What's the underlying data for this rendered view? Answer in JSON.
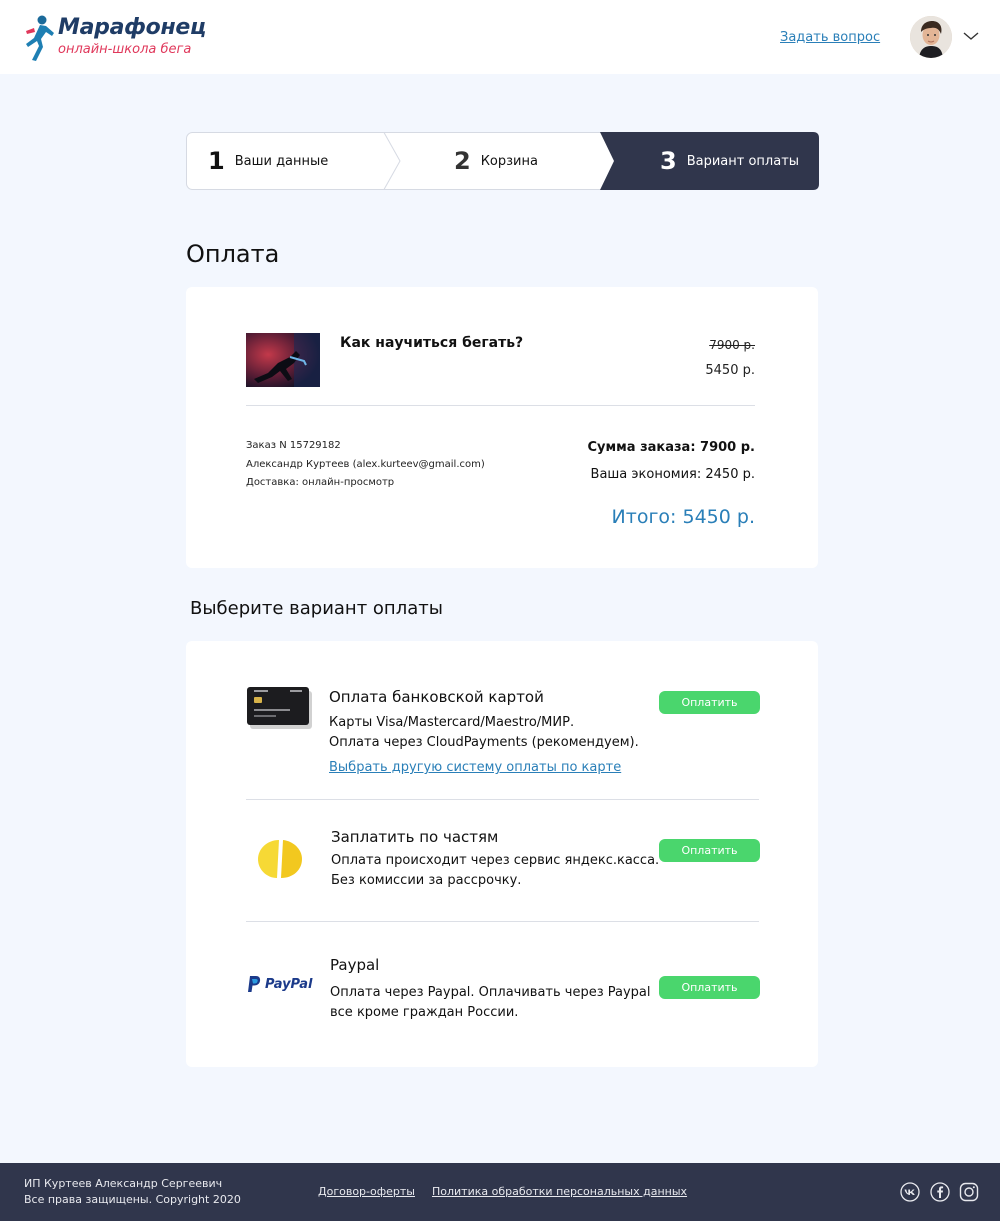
{
  "header": {
    "logo_name": "Марафонец",
    "logo_sub": "онлайн-школа бега",
    "ask_link": "Задать вопрос"
  },
  "stepper": {
    "steps": [
      {
        "num": "1",
        "label": "Ваши данные"
      },
      {
        "num": "2",
        "label": "Корзина"
      },
      {
        "num": "3",
        "label": "Вариант оплаты"
      }
    ],
    "active_color": "#30364c"
  },
  "page_title": "Оплата",
  "order": {
    "course_title": "Как научиться бегать?",
    "old_price": "7900 р.",
    "new_price": "5450 р.",
    "order_number": "Заказ N 15729182",
    "customer": "Александр Куртеев (alex.kurteev@gmail.com)",
    "delivery": "Доставка: онлайн-просмотр",
    "sum": "Сумма заказа: 7900 р.",
    "economy": "Ваша экономия: 2450 р.",
    "total": "Итого: 5450 р."
  },
  "choose_title": "Выберите вариант оплаты",
  "payments": [
    {
      "icon": "bank-card-icon",
      "title": "Оплата банковской картой",
      "desc1": "Карты Visa/Mastercard/Maestro/МИР.",
      "desc2": "Оплата через CloudPayments (рекомендуем).",
      "link": "Выбрать другую систему оплаты по карте",
      "button": "Оплатить"
    },
    {
      "icon": "yandex-kassa-icon",
      "title": "Заплатить по частям",
      "desc1": "Оплата происходит через сервис яндекс.касса.",
      "desc2": "Без комиссии за рассрочку.",
      "button": "Оплатить"
    },
    {
      "icon": "paypal-icon",
      "logo_text": "PayPal",
      "title": "Paypal",
      "desc1": "Оплата через Paypal. Оплачивать через Paypal",
      "desc2": "все кроме граждан России.",
      "button": "Оплатить"
    }
  ],
  "footer": {
    "company": "ИП Куртеев Александр Сергеевич",
    "rights": "Все права защищены. Copyright 2020",
    "links": [
      "Договор-оферты",
      "Политика обработки персональных данных"
    ],
    "socials": [
      "vk-icon",
      "facebook-icon",
      "instagram-icon"
    ]
  },
  "colors": {
    "accent": "#2a7fb8",
    "pay_button": "#4ad66d",
    "footer_bg": "#30364c",
    "page_bg": "#f3f7fe"
  }
}
